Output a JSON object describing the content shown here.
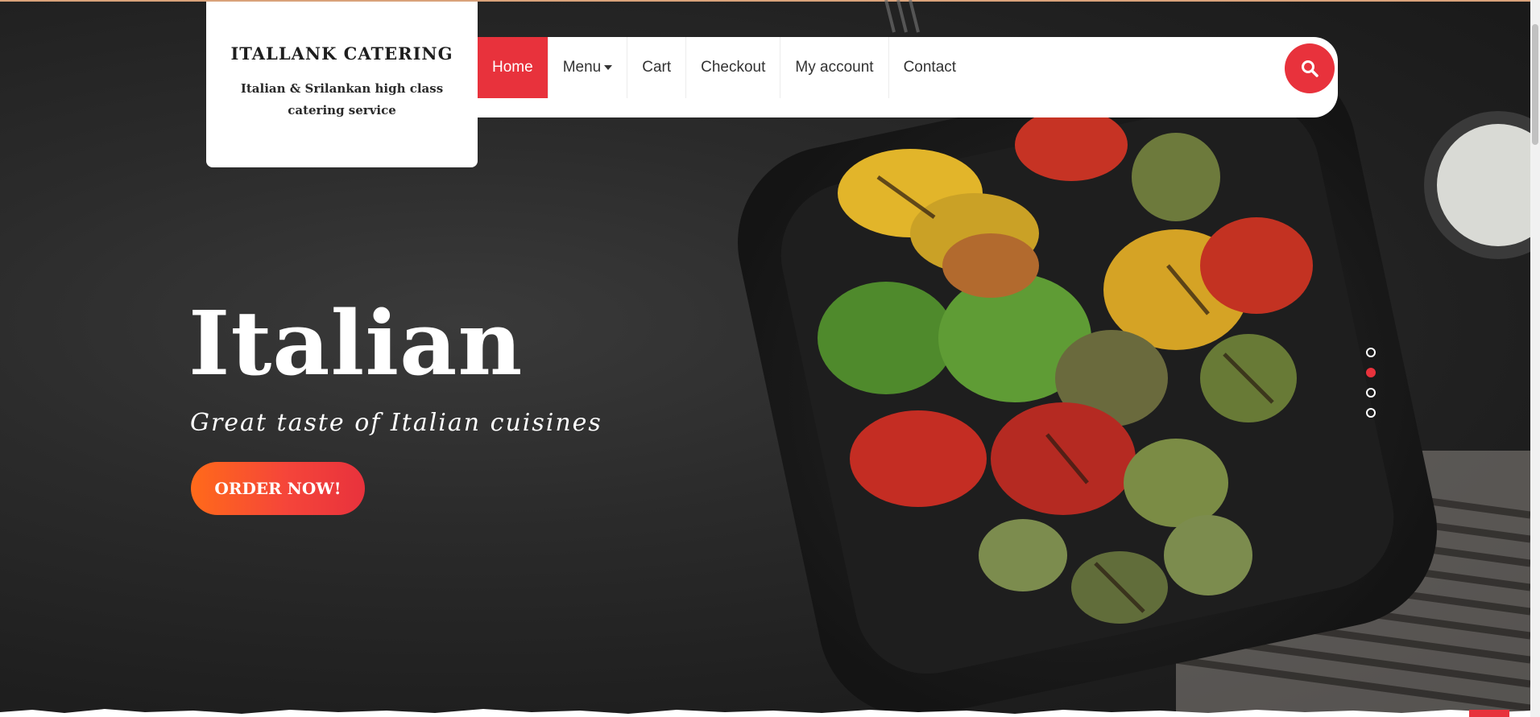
{
  "brand": {
    "title": "ITALLANK CATERING",
    "tagline": "Italian & Srilankan high class catering service"
  },
  "nav": {
    "items": [
      {
        "label": "Home",
        "active": true
      },
      {
        "label": "Menu",
        "dropdown": true
      },
      {
        "label": "Cart"
      },
      {
        "label": "Checkout"
      },
      {
        "label": "My account"
      },
      {
        "label": "Contact"
      }
    ],
    "search_icon": "search-icon"
  },
  "hero": {
    "title": "Italian",
    "subtitle": "Great taste of Italian cuisines",
    "cta_label": "ORDER NOW!"
  },
  "slider": {
    "count": 4,
    "active_index": 1
  },
  "colors": {
    "accent": "#e8323c",
    "cta_gradient_start": "#ff6a1a",
    "cta_gradient_end": "#e8323c",
    "background_dark": "#2b2b2b"
  }
}
